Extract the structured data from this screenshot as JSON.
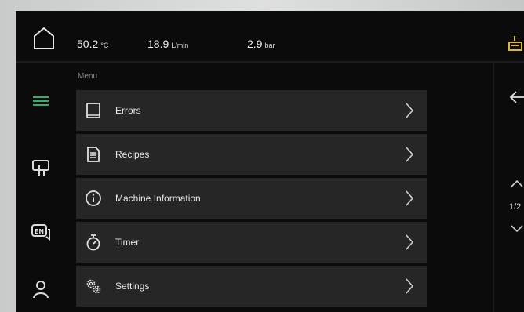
{
  "topbar": {
    "temperature": {
      "value": "50.2",
      "unit": "°C"
    },
    "flow": {
      "value": "18.9",
      "unit": "L/min"
    },
    "pressure": {
      "value": "2.9",
      "unit": "bar"
    }
  },
  "colors": {
    "accent_green": "#2fb36b",
    "alarm_yellow": "#e0b82c",
    "menu_item_bg": "#262626",
    "screen_bg": "#0b0b0b"
  },
  "sidebar": {
    "items": [
      {
        "icon": "hamburger-menu-icon",
        "active": true
      },
      {
        "icon": "touch-screen-icon"
      },
      {
        "icon": "language-en-icon",
        "badge": "EN"
      },
      {
        "icon": "user-icon"
      }
    ]
  },
  "menu": {
    "heading": "Menu",
    "items": [
      {
        "label": "Errors",
        "icon": "book-icon"
      },
      {
        "label": "Recipes",
        "icon": "document-icon"
      },
      {
        "label": "Machine Information",
        "icon": "info-icon"
      },
      {
        "label": "Timer",
        "icon": "stopwatch-icon"
      },
      {
        "label": "Settings",
        "icon": "gears-icon"
      }
    ]
  },
  "pager": {
    "label": "1/2"
  }
}
